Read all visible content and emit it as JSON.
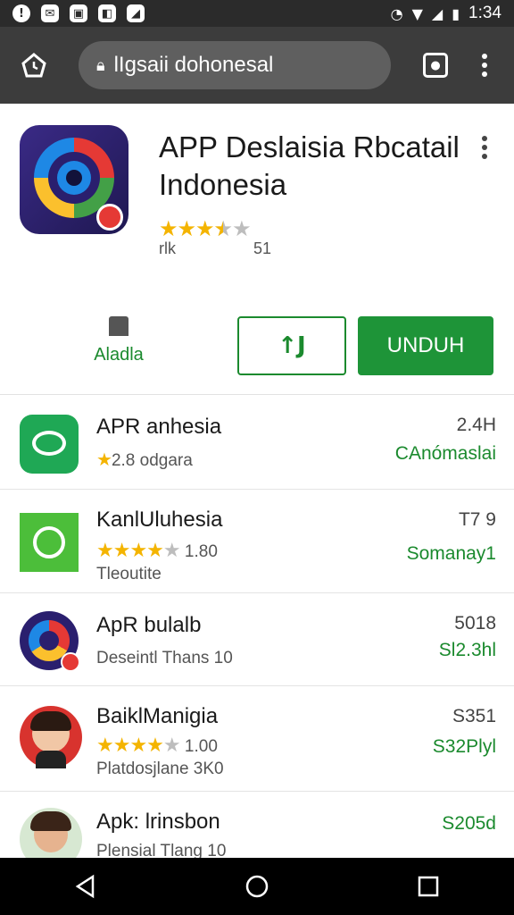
{
  "status_bar": {
    "left_icons": [
      "alert-icon",
      "mail-icon",
      "message-icon",
      "chat-icon",
      "app-icon"
    ],
    "time": "1:34"
  },
  "browser": {
    "url": "lIgsaii dohonesal"
  },
  "app": {
    "title": "APP Deslaisia Rbcatail Indonesia",
    "rating_stars": 3.5,
    "rating_count_label": "rlk",
    "size_label": "51",
    "wishlist_label": "Aladla",
    "secondary_button_label": "↑J",
    "install_label": "UNDUH"
  },
  "list": [
    {
      "title": "APR anhesia",
      "sub_rating_text": "2.8 odgara",
      "stars": 1,
      "right_top": "2.4H",
      "right_bottom": "CAnómaslai"
    },
    {
      "title": "KanlUluhesia",
      "stars": 4,
      "rating_value": "1.80",
      "sub": "Tleoutite",
      "right_top": "T7 9",
      "right_bottom": "Somanay1"
    },
    {
      "title": "ApR bulalb",
      "sub": "Deseintl Thans 10",
      "right_top": "5018",
      "right_bottom": "Sl2.3hl"
    },
    {
      "title": "BaiklManigia",
      "stars": 4,
      "rating_value": "1.00",
      "sub": "Platdosjlane 3K0",
      "right_top": "S351",
      "right_bottom": "S32Plyl"
    },
    {
      "title": "Apk: lrinsbon",
      "sub": "Plensial Tlang 10",
      "right_top": "S205d",
      "right_bottom": ""
    }
  ],
  "colors": {
    "accent_green": "#1e9438",
    "status_bar": "#2b2b2b",
    "toolbar": "#3c3c3c",
    "star": "#f4b400"
  }
}
